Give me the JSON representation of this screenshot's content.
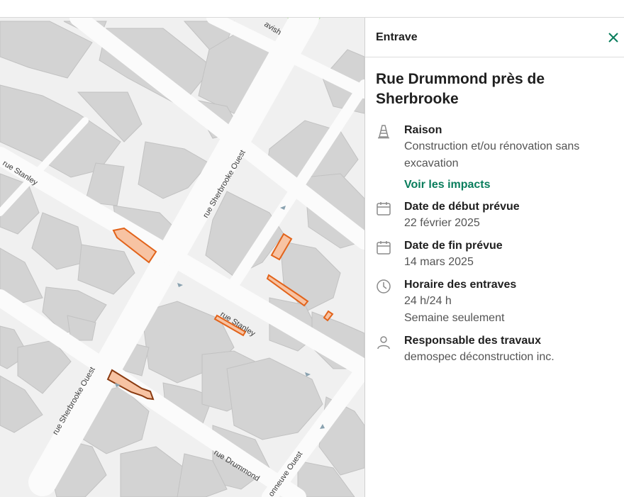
{
  "panel": {
    "header_title": "Entrave",
    "close_icon": "close-icon",
    "heading": "Rue Drummond près de Sherbrooke",
    "accent_color": "#097d5c",
    "reason": {
      "icon": "traffic-cone-icon",
      "label": "Raison",
      "value": "Construction et/ou rénovation sans excavation",
      "link": "Voir les impacts"
    },
    "start": {
      "icon": "calendar-icon",
      "label": "Date de début prévue",
      "value": "22 février 2025"
    },
    "end": {
      "icon": "calendar-icon",
      "label": "Date de fin prévue",
      "value": "14 mars 2025"
    },
    "schedule": {
      "icon": "clock-icon",
      "label": "Horaire des entraves",
      "value_1": "24 h/24 h",
      "value_2": "Semaine seulement"
    },
    "responsible": {
      "icon": "person-icon",
      "label": "Responsable des travaux",
      "value": "demospec déconstruction inc."
    }
  },
  "map": {
    "streets": {
      "cavish": "avish",
      "stanley_west": "rue Stanley",
      "stanley_east": "rue Stanley",
      "sherbrooke_north": "rue Sherbrooke Ouest",
      "sherbrooke_south": "rue Sherbrooke Ouest",
      "drummond": "rue Drummond",
      "maisonneuve": "onneuve Ouest"
    },
    "colors": {
      "obstruction_fill": "#f7c3a3",
      "obstruction_stroke": "#e2631a",
      "selected_stroke": "#8a3a10",
      "building": "#d2d2d2",
      "park": "#b9e4a8"
    }
  }
}
